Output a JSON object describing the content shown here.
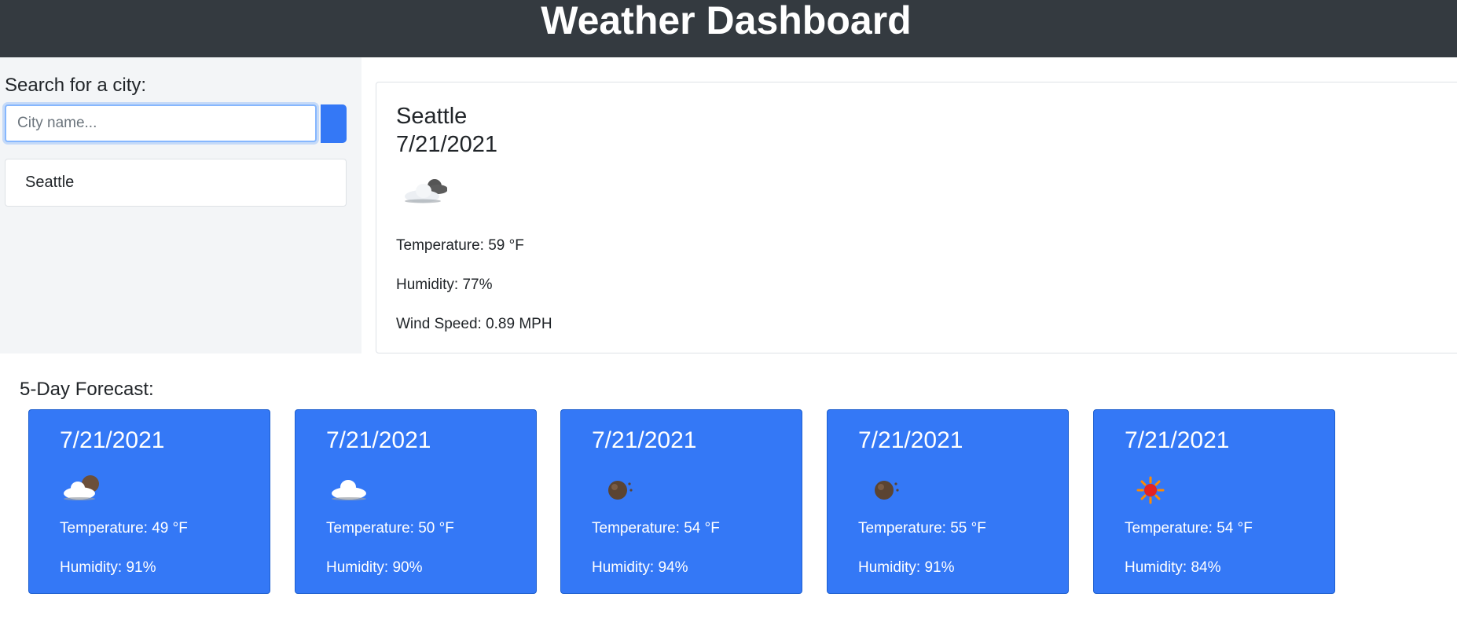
{
  "header": {
    "title": "Weather Dashboard"
  },
  "search": {
    "label": "Search for a city:",
    "placeholder": "City name...",
    "value": "",
    "button_color": "#3478f6"
  },
  "history": [
    {
      "city": "Seattle"
    }
  ],
  "current": {
    "city": "Seattle",
    "date": "7/21/2021",
    "icon": "cloudy-night-icon",
    "temperature": "Temperature: 59 °F",
    "humidity": "Humidity: 77%",
    "wind": "Wind Speed: 0.89 MPH"
  },
  "forecast": {
    "title": "5-Day Forecast:",
    "card_color": "#3478f6",
    "days": [
      {
        "date": "7/21/2021",
        "icon": "cloud-with-moon-icon",
        "temperature": "Temperature: 49 °F",
        "humidity": "Humidity: 91%"
      },
      {
        "date": "7/21/2021",
        "icon": "cloud-icon",
        "temperature": "Temperature: 50 °F",
        "humidity": "Humidity: 90%"
      },
      {
        "date": "7/21/2021",
        "icon": "moon-icon",
        "temperature": "Temperature: 54 °F",
        "humidity": "Humidity: 94%"
      },
      {
        "date": "7/21/2021",
        "icon": "moon-icon",
        "temperature": "Temperature: 55 °F",
        "humidity": "Humidity: 91%"
      },
      {
        "date": "7/21/2021",
        "icon": "sun-icon",
        "temperature": "Temperature: 54 °F",
        "humidity": "Humidity: 84%"
      }
    ]
  }
}
